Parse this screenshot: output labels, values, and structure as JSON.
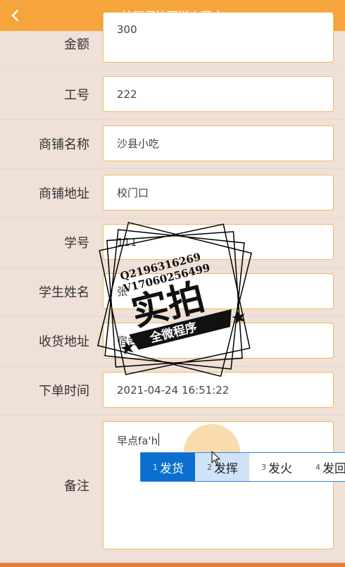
{
  "header": {
    "title": "校园餐饮配送小程序",
    "back_icon": "chevron-left-icon"
  },
  "fields": [
    {
      "label": "金额",
      "value": "300"
    },
    {
      "label": "工号",
      "value": "222"
    },
    {
      "label": "商铺名称",
      "value": "沙县小吃"
    },
    {
      "label": "商铺地址",
      "value": "校门口"
    },
    {
      "label": "学号",
      "value": "111"
    },
    {
      "label": "学生姓名",
      "value": "张"
    },
    {
      "label": "收货地址",
      "value": "宿舍30"
    },
    {
      "label": "下单时间",
      "value": "2021-04-24 16:51:22"
    },
    {
      "label": "备注",
      "value": "早点fa'h"
    }
  ],
  "ime_candidates": [
    {
      "num": "1",
      "text": "发货"
    },
    {
      "num": "2",
      "text": "发挥"
    },
    {
      "num": "3",
      "text": "发火"
    },
    {
      "num": "4",
      "text": "发回"
    }
  ],
  "watermark": {
    "qq": "Q2196316269",
    "wx": "V17060256499",
    "main": "实拍",
    "ribbon": "全微程序"
  },
  "colors": {
    "header": "#f5a53c",
    "background": "#efe1d8",
    "field_border": "#f3b75d",
    "ime_selected": "#0b6fcf"
  }
}
